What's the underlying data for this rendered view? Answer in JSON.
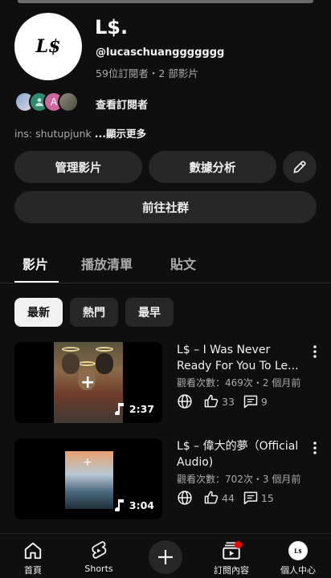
{
  "channel": {
    "avatar_text": "L$",
    "name": "L$.",
    "handle": "@lucaschuanggggggg",
    "stats": "59位訂閱者・2 部影片",
    "subscribers_link": "查看訂閱者",
    "subscriber_avatar_letter": "A",
    "bio": "ins: shutupjunk ",
    "bio_more": "...顯示更多"
  },
  "actions": {
    "manage_videos": "管理影片",
    "analytics": "數據分析",
    "community": "前往社群"
  },
  "tabs": [
    {
      "label": "影片",
      "active": true
    },
    {
      "label": "播放清單",
      "active": false
    },
    {
      "label": "貼文",
      "active": false
    }
  ],
  "sort_chips": [
    {
      "label": "最新",
      "active": true
    },
    {
      "label": "熱門",
      "active": false
    },
    {
      "label": "最早",
      "active": false
    }
  ],
  "videos": [
    {
      "title": "L$ – I Was Never Ready For You To Le...",
      "meta": "觀看次數：469次・2 個月前",
      "likes": "33",
      "comments": "9",
      "duration": "2:37"
    },
    {
      "title": "L$ – 偉大的夢（Official Audio)",
      "meta": "觀看次數：702次・3 個月前",
      "likes": "44",
      "comments": "15",
      "duration": "3:04"
    }
  ],
  "bottom_nav": {
    "home": "首頁",
    "shorts": "Shorts",
    "subscriptions": "訂閱內容",
    "you": "個人中心",
    "you_avatar_text": "L$"
  },
  "colors": {
    "background": "#0f0f0f",
    "button": "#272727",
    "secondary_text": "#aaaaaa",
    "notification": "#ff0000"
  }
}
